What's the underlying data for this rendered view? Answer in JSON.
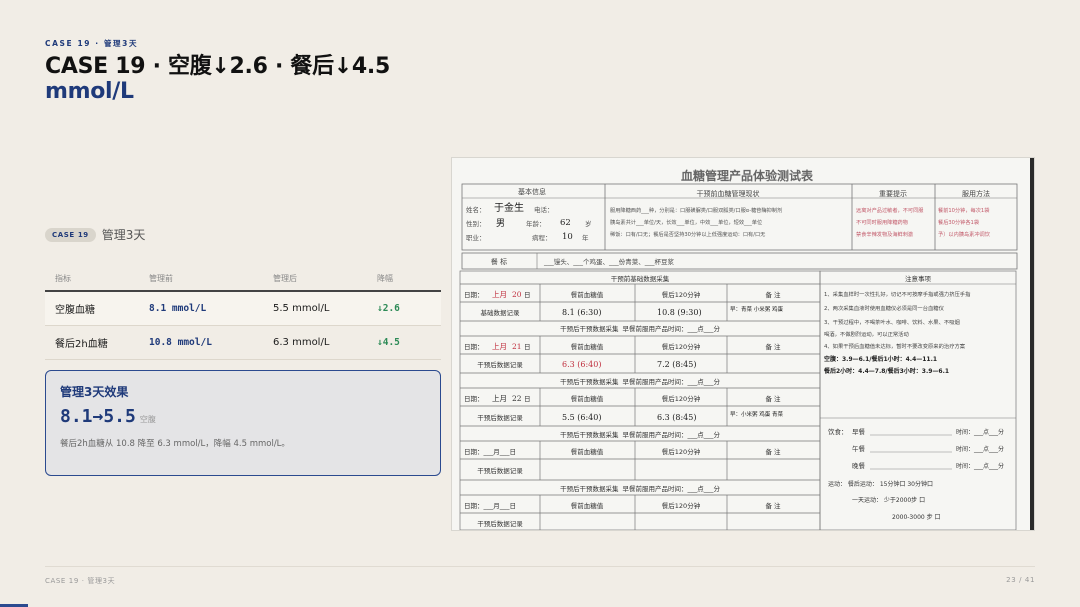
{
  "header": {
    "eyebrow": "CASE 19 · 管理3天",
    "title_line1": "CASE 19 · 空腹↓2.6 · 餐后↓4.5",
    "title_line2": "mmol/L"
  },
  "tag": {
    "pill": "CASE 19",
    "text": "管理3天"
  },
  "table": {
    "headers": [
      "指标",
      "管理前",
      "管理后",
      "降幅"
    ],
    "rows": [
      {
        "metric": "空腹血糖",
        "before": "8.1 mmol/L",
        "after": "5.5 mmol/L",
        "drop": "↓2.6"
      },
      {
        "metric": "餐后2h血糖",
        "before": "10.8 mmol/L",
        "after": "6.3 mmol/L",
        "drop": "↓4.5"
      }
    ]
  },
  "card": {
    "title": "管理3天效果",
    "big": "8.1→5.5",
    "big_note": "空腹",
    "note": "餐后2h血糖从 10.8 降至 6.3 mmol/L，降幅 4.5 mmol/L。"
  },
  "form": {
    "title": "血糖管理产品体验测试表",
    "basic_info": "基本信息",
    "pre_status": "干预前血糖管理现状",
    "tips": "重要提示",
    "usage": "服用方法",
    "name_label": "姓名：",
    "name_value": "于金生",
    "gender_label": "性别：",
    "gender_value": "男",
    "age_label": "年龄：",
    "age_value": "62",
    "age_unit": "岁",
    "job_label": "职业：",
    "course_label": "病程：",
    "course_value": "10",
    "course_unit": "年",
    "phone_label": "电话：",
    "status_lines": [
      "服用降糖西药___种，分别是：口服磺脲类/口服双胍类/口服α-糖苷酶抑制剂",
      "胰岛素共计___单位/天，长效___单位，中效___单位，短效___单位",
      "稀饭：口有/口无；餐后是否坚持30分钟以上低强度运动：口有/口无"
    ],
    "tips_lines": [
      "远离对产品过敏者，不可同服",
      "不可同时服用降糖药物",
      "禁食辛辣发物及海鲜刺激"
    ],
    "usage_lines": [
      "餐前10分钟，每次1袋",
      "餐后30分钟各1袋",
      "予）以内胰岛素冲调饮"
    ],
    "meal_label": "餐  标",
    "meal_text": "___馒头、___个鸡蛋、___份青菜、___杯豆浆",
    "section_pre": "干预前基础数据采集",
    "date_label": "日期：",
    "date_month": "上月",
    "date_day": "20",
    "day": "日",
    "col_fasting": "餐前血糖值",
    "col_after": "餐后120分钟",
    "col_note": "备  注",
    "row_basic": "基础数据记录",
    "row_after": "干预后数据记录",
    "basic_fasting": "8.1 (6:30)",
    "basic_after": "10.8 (9:30)",
    "basic_note": "早：青菜 小米粥 鸡蛋",
    "section_post": "干预后干预数据采集",
    "post_time": "早餐前服用产品时间：___点___分",
    "d2_day": "21",
    "d2_fasting": "6.3 (6:40)",
    "d2_after": "7.2 (8:45)",
    "d3_day": "22",
    "d3_fasting": "5.5 (6:40)",
    "d3_after": "6.3 (8:45)",
    "d3_note": "早：小米粥 鸡蛋 青菜",
    "blank_date": "日期：___月___日",
    "notes_title": "注意事项",
    "notes_lines": [
      "1、采集血样时一次性扎好，切记不可按摩手指或强力挤压手指",
      "2、两次采集血液时使用血糖仪必须是同一台血糖仪",
      "3、干预过程中，不喝茶叶水、咖啡、饮料、水果、不吸烟",
      "喝酒，不做剧烈运动，可以正常活动",
      "4、如果干预后血糖值未达标，暂时不要改变原来的治疗方案"
    ],
    "target_fasting": "空腹：3.9—6.1/餐后1小时：4.4—11.1",
    "target_after": "餐后2小时：4.4—7.8/餐后3小时：3.9—6.1",
    "diet_label": "饮食：",
    "breakfast": "早餐",
    "lunch": "午餐",
    "dinner": "晚餐",
    "time_text": "时间：___点___分",
    "exercise": "运动：  餐后运动：  15分钟口    30分钟口",
    "daily": "一天运动：  少于2000步  口",
    "daily2": "2000-3000 步  口"
  },
  "footer": {
    "left": "CASE 19 · 管理3天",
    "right": "23 / 41"
  },
  "colors": {
    "accent": "#1f3a7a",
    "down": "#2e8b57",
    "background": "#f1ede6"
  }
}
